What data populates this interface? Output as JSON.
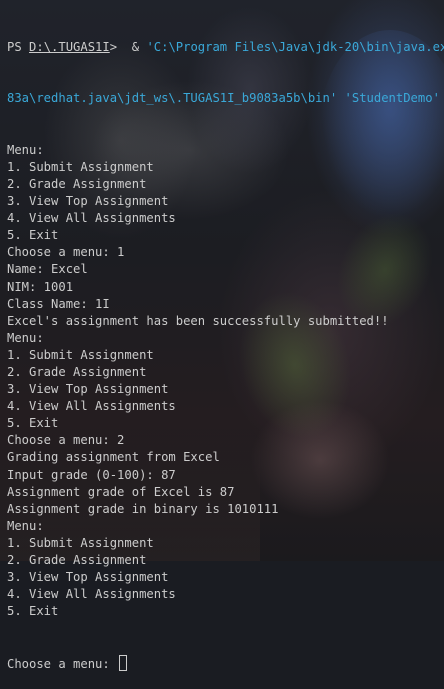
{
  "terminal": {
    "prompt_prefix": "PS ",
    "prompt_path": "D:\\.TUGAS1I",
    "prompt_suffix": ">  ",
    "cmd_operator": "& ",
    "cmd_line1": "'C:\\Program Files\\Java\\jdk-20\\bin\\java.exe'",
    "cmd_line2": "83a\\redhat.java\\jdt_ws\\.TUGAS1I_b9083a5b\\bin' 'StudentDemo'",
    "lines": [
      "Menu:",
      "1. Submit Assignment",
      "2. Grade Assignment",
      "3. View Top Assignment",
      "4. View All Assignments",
      "5. Exit",
      "Choose a menu: 1",
      "Name: Excel",
      "NIM: 1001",
      "Class Name: 1I",
      "Excel's assignment has been successfully submitted!!",
      "Menu:",
      "1. Submit Assignment",
      "2. Grade Assignment",
      "3. View Top Assignment",
      "4. View All Assignments",
      "5. Exit",
      "Choose a menu: 2",
      "Grading assignment from Excel",
      "Input grade (0-100): 87",
      "Assignment grade of Excel is 87",
      "Assignment grade in binary is 1010111",
      "Menu:",
      "1. Submit Assignment",
      "2. Grade Assignment",
      "3. View Top Assignment",
      "4. View All Assignments",
      "5. Exit"
    ],
    "final_prompt": "Choose a menu: "
  },
  "colors": {
    "text": "#cccccc",
    "string_cyan": "#3aa8d8",
    "background": "#1a1c22"
  }
}
